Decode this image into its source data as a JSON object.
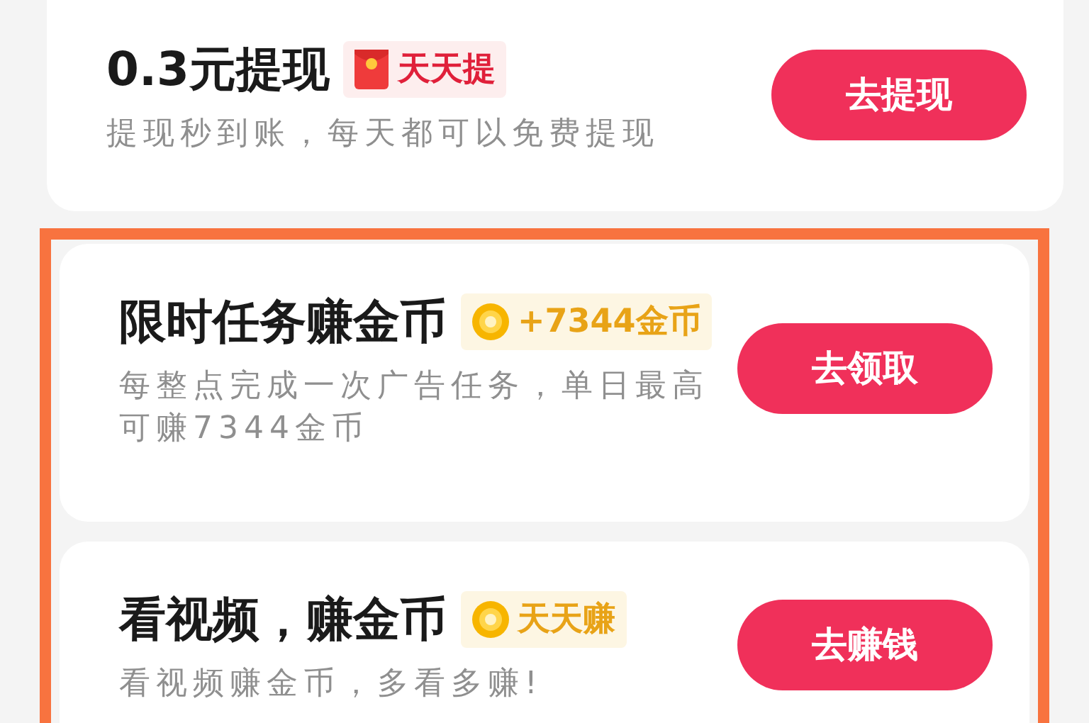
{
  "cards": [
    {
      "title": "0.3元提现",
      "badge": {
        "kind": "redpacket",
        "label": "天天提"
      },
      "subtitle": "提现秒到账，每天都可以免费提现",
      "button": "去提现",
      "highlighted": false
    },
    {
      "title": "限时任务赚金币",
      "badge": {
        "kind": "coin",
        "label": "+7344金币"
      },
      "subtitle": "每整点完成一次广告任务，单日最高可赚7344金币",
      "button": "去领取",
      "highlighted": true
    },
    {
      "title": "看视频，赚金币",
      "badge": {
        "kind": "coin",
        "label": "天天赚"
      },
      "subtitle": "看视频赚金币，多看多赚!",
      "button": "去赚钱",
      "highlighted": true
    }
  ]
}
